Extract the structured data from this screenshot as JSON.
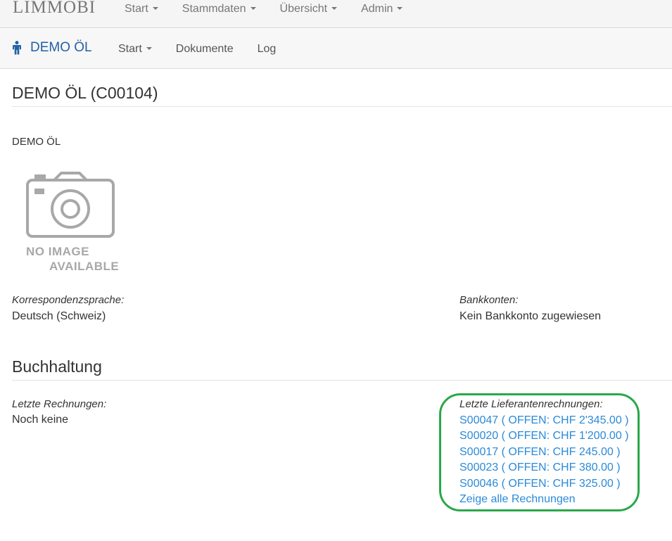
{
  "topbar": {
    "brand": "LIMMOBI",
    "menu": [
      {
        "label": "Start"
      },
      {
        "label": "Stammdaten"
      },
      {
        "label": "Übersicht"
      },
      {
        "label": "Admin"
      }
    ]
  },
  "subbar": {
    "brand": "DEMO ÖL",
    "brand_icon": "person-icon",
    "menu": [
      {
        "label": "Start"
      },
      {
        "label": "Dokumente"
      },
      {
        "label": "Log"
      }
    ]
  },
  "page": {
    "title": "DEMO ÖL (C00104)",
    "company_name": "DEMO ÖL",
    "image_placeholder": {
      "line1": "NO IMAGE",
      "line2": "AVAILABLE",
      "icon": "camera-icon"
    },
    "correspondence_language": {
      "label": "Korrespondenzsprache:",
      "value": "Deutsch (Schweiz)"
    },
    "bank_accounts": {
      "label": "Bankkonten:",
      "value": "Kein Bankkonto zugewiesen"
    }
  },
  "accounting": {
    "title": "Buchhaltung",
    "recent_invoices": {
      "label": "Letzte Rechnungen:",
      "value": "Noch keine"
    },
    "recent_supplier_invoices": {
      "label": "Letzte Lieferantenrechnungen:",
      "items": [
        {
          "text": "S00047 ( OFFEN: CHF 2'345.00 )"
        },
        {
          "text": "S00020 ( OFFEN: CHF 1'200.00 )"
        },
        {
          "text": "S00017 ( OFFEN: CHF 245.00 )"
        },
        {
          "text": "S00023 ( OFFEN: CHF 380.00 )"
        },
        {
          "text": "S00046 ( OFFEN: CHF 325.00 )"
        }
      ],
      "show_all": "Zeige alle Rechnungen"
    },
    "highlight_color": "#2aa84a"
  },
  "colors": {
    "link": "#2a8ad8",
    "brand_blue": "#2361a5",
    "navbar_bg": "#f5f5f5"
  }
}
